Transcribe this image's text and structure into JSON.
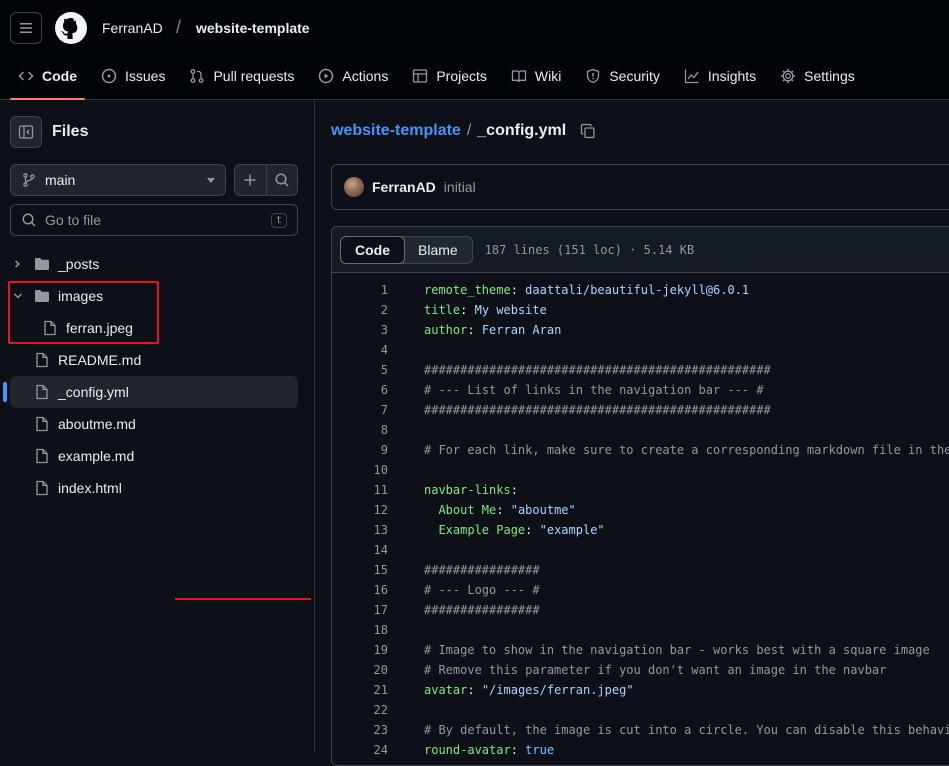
{
  "header": {
    "owner": "FerranAD",
    "repo": "website-template",
    "tabs": [
      {
        "label": "Code",
        "icon": "code-icon",
        "active": true
      },
      {
        "label": "Issues",
        "icon": "issue-icon"
      },
      {
        "label": "Pull requests",
        "icon": "pull-request-icon"
      },
      {
        "label": "Actions",
        "icon": "play-icon"
      },
      {
        "label": "Projects",
        "icon": "table-icon"
      },
      {
        "label": "Wiki",
        "icon": "book-icon"
      },
      {
        "label": "Security",
        "icon": "shield-icon"
      },
      {
        "label": "Insights",
        "icon": "graph-icon"
      },
      {
        "label": "Settings",
        "icon": "gear-icon"
      }
    ]
  },
  "sidebar": {
    "title": "Files",
    "branch": "main",
    "goto_placeholder": "Go to file",
    "goto_shortcut": "t",
    "tree": [
      {
        "name": "_posts",
        "type": "folder",
        "expanded": false
      },
      {
        "name": "images",
        "type": "folder",
        "expanded": true
      },
      {
        "name": "ferran.jpeg",
        "type": "file"
      },
      {
        "name": "README.md",
        "type": "file"
      },
      {
        "name": "_config.yml",
        "type": "file",
        "selected": true
      },
      {
        "name": "aboutme.md",
        "type": "file"
      },
      {
        "name": "example.md",
        "type": "file"
      },
      {
        "name": "index.html",
        "type": "file"
      }
    ]
  },
  "main": {
    "breadcrumb_repo": "website-template",
    "breadcrumb_sep": "/",
    "breadcrumb_file": "_config.yml",
    "commit_author": "FerranAD",
    "commit_message": "initial",
    "code_tab": "Code",
    "blame_tab": "Blame",
    "file_info": "187 lines (151 loc) · 5.14 KB",
    "lines": [
      {
        "n": "1",
        "k": "remote_theme",
        "v": "daattali/beautiful-jekyll@6.0.1"
      },
      {
        "n": "2",
        "k": "title",
        "v": "My website"
      },
      {
        "n": "3",
        "k": "author",
        "v": "Ferran Aran"
      },
      {
        "n": "4",
        "t": ""
      },
      {
        "n": "5",
        "c": "################################################"
      },
      {
        "n": "6",
        "c": "# --- List of links in the navigation bar --- #"
      },
      {
        "n": "7",
        "c": "################################################"
      },
      {
        "n": "8",
        "t": ""
      },
      {
        "n": "9",
        "c": "# For each link, make sure to create a corresponding markdown file in the"
      },
      {
        "n": "10",
        "t": ""
      },
      {
        "n": "11",
        "k": "navbar-links",
        "v": ""
      },
      {
        "n": "12",
        "k": "  About Me",
        "v": "\"aboutme\""
      },
      {
        "n": "13",
        "k": "  Example Page",
        "v": "\"example\""
      },
      {
        "n": "14",
        "t": ""
      },
      {
        "n": "15",
        "c": "################"
      },
      {
        "n": "16",
        "c": "# --- Logo --- #"
      },
      {
        "n": "17",
        "c": "################"
      },
      {
        "n": "18",
        "t": ""
      },
      {
        "n": "19",
        "c": "# Image to show in the navigation bar - works best with a square image"
      },
      {
        "n": "20",
        "c": "# Remove this parameter if you don't want an image in the navbar"
      },
      {
        "n": "21",
        "k": "avatar",
        "v": "\"/images/ferran.jpeg\""
      },
      {
        "n": "22",
        "t": ""
      },
      {
        "n": "23",
        "c": "# By default, the image is cut into a circle. You can disable this behavi"
      },
      {
        "n": "24",
        "k": "round-avatar",
        "b": "true"
      }
    ]
  }
}
